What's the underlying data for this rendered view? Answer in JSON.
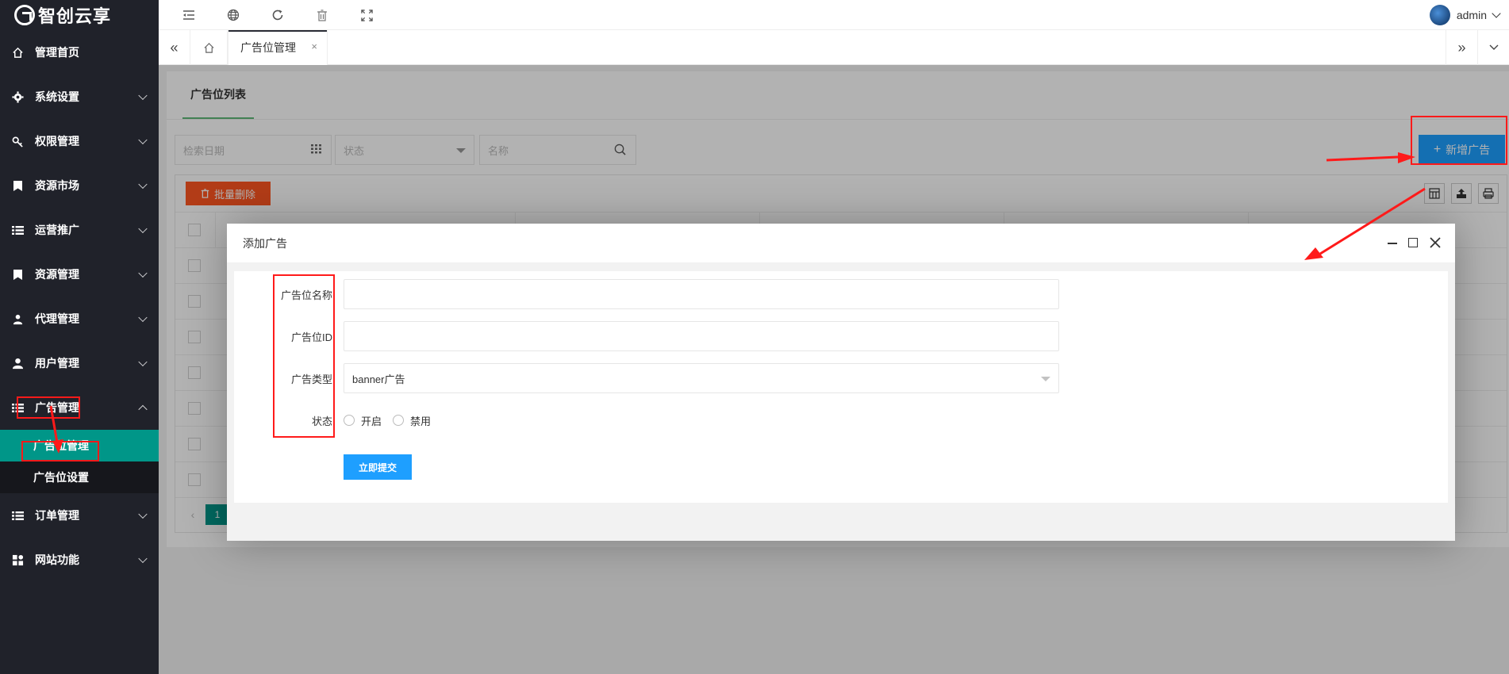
{
  "app": {
    "logo_text": "智创云享"
  },
  "sidebar": {
    "items": [
      {
        "label": "管理首页",
        "icon": "home-icon",
        "has_children": false
      },
      {
        "label": "系统设置",
        "icon": "gear-icon",
        "has_children": true
      },
      {
        "label": "权限管理",
        "icon": "key-icon",
        "has_children": true
      },
      {
        "label": "资源市场",
        "icon": "bookmark-icon",
        "has_children": true
      },
      {
        "label": "运营推广",
        "icon": "list-icon",
        "has_children": true
      },
      {
        "label": "资源管理",
        "icon": "bookmark-icon",
        "has_children": true
      },
      {
        "label": "代理管理",
        "icon": "user-group-icon",
        "has_children": true
      },
      {
        "label": "用户管理",
        "icon": "user-icon",
        "has_children": true
      },
      {
        "label": "广告管理",
        "icon": "list-icon",
        "has_children": true,
        "expanded": true
      },
      {
        "label": "订单管理",
        "icon": "list-icon",
        "has_children": true
      },
      {
        "label": "网站功能",
        "icon": "apps-icon",
        "has_children": true
      }
    ],
    "ad_sub_items": [
      {
        "label": "广告位管理",
        "active": true
      },
      {
        "label": "广告位设置",
        "active": false
      }
    ]
  },
  "topbar": {
    "icons": [
      "menu-fold-icon",
      "globe-icon",
      "refresh-icon",
      "trash-icon",
      "fullscreen-icon"
    ],
    "username": "admin"
  },
  "tabs": {
    "active_tab": "广告位管理",
    "close_symbol": "×"
  },
  "page": {
    "card_tab": "广告位列表",
    "filters": {
      "date_placeholder": "检索日期",
      "status_placeholder": "状态",
      "name_placeholder": "名称"
    },
    "add_button": "新增广告",
    "batch_delete": "批量删除",
    "pager": {
      "current_page": "1"
    }
  },
  "modal": {
    "title": "添加广告",
    "fields": {
      "name_label": "广告位名称",
      "name_value": "",
      "id_label": "广告位ID",
      "id_value": "",
      "type_label": "广告类型",
      "type_value": "banner广告",
      "status_label": "状态",
      "status_options": [
        "开启",
        "禁用"
      ]
    },
    "submit": "立即提交"
  },
  "colors": {
    "sidebar_bg": "#20222a",
    "active_green": "#009688",
    "primary_blue": "#1e9fff",
    "danger": "#ff5722",
    "annotation_red": "#ff1a1a"
  }
}
